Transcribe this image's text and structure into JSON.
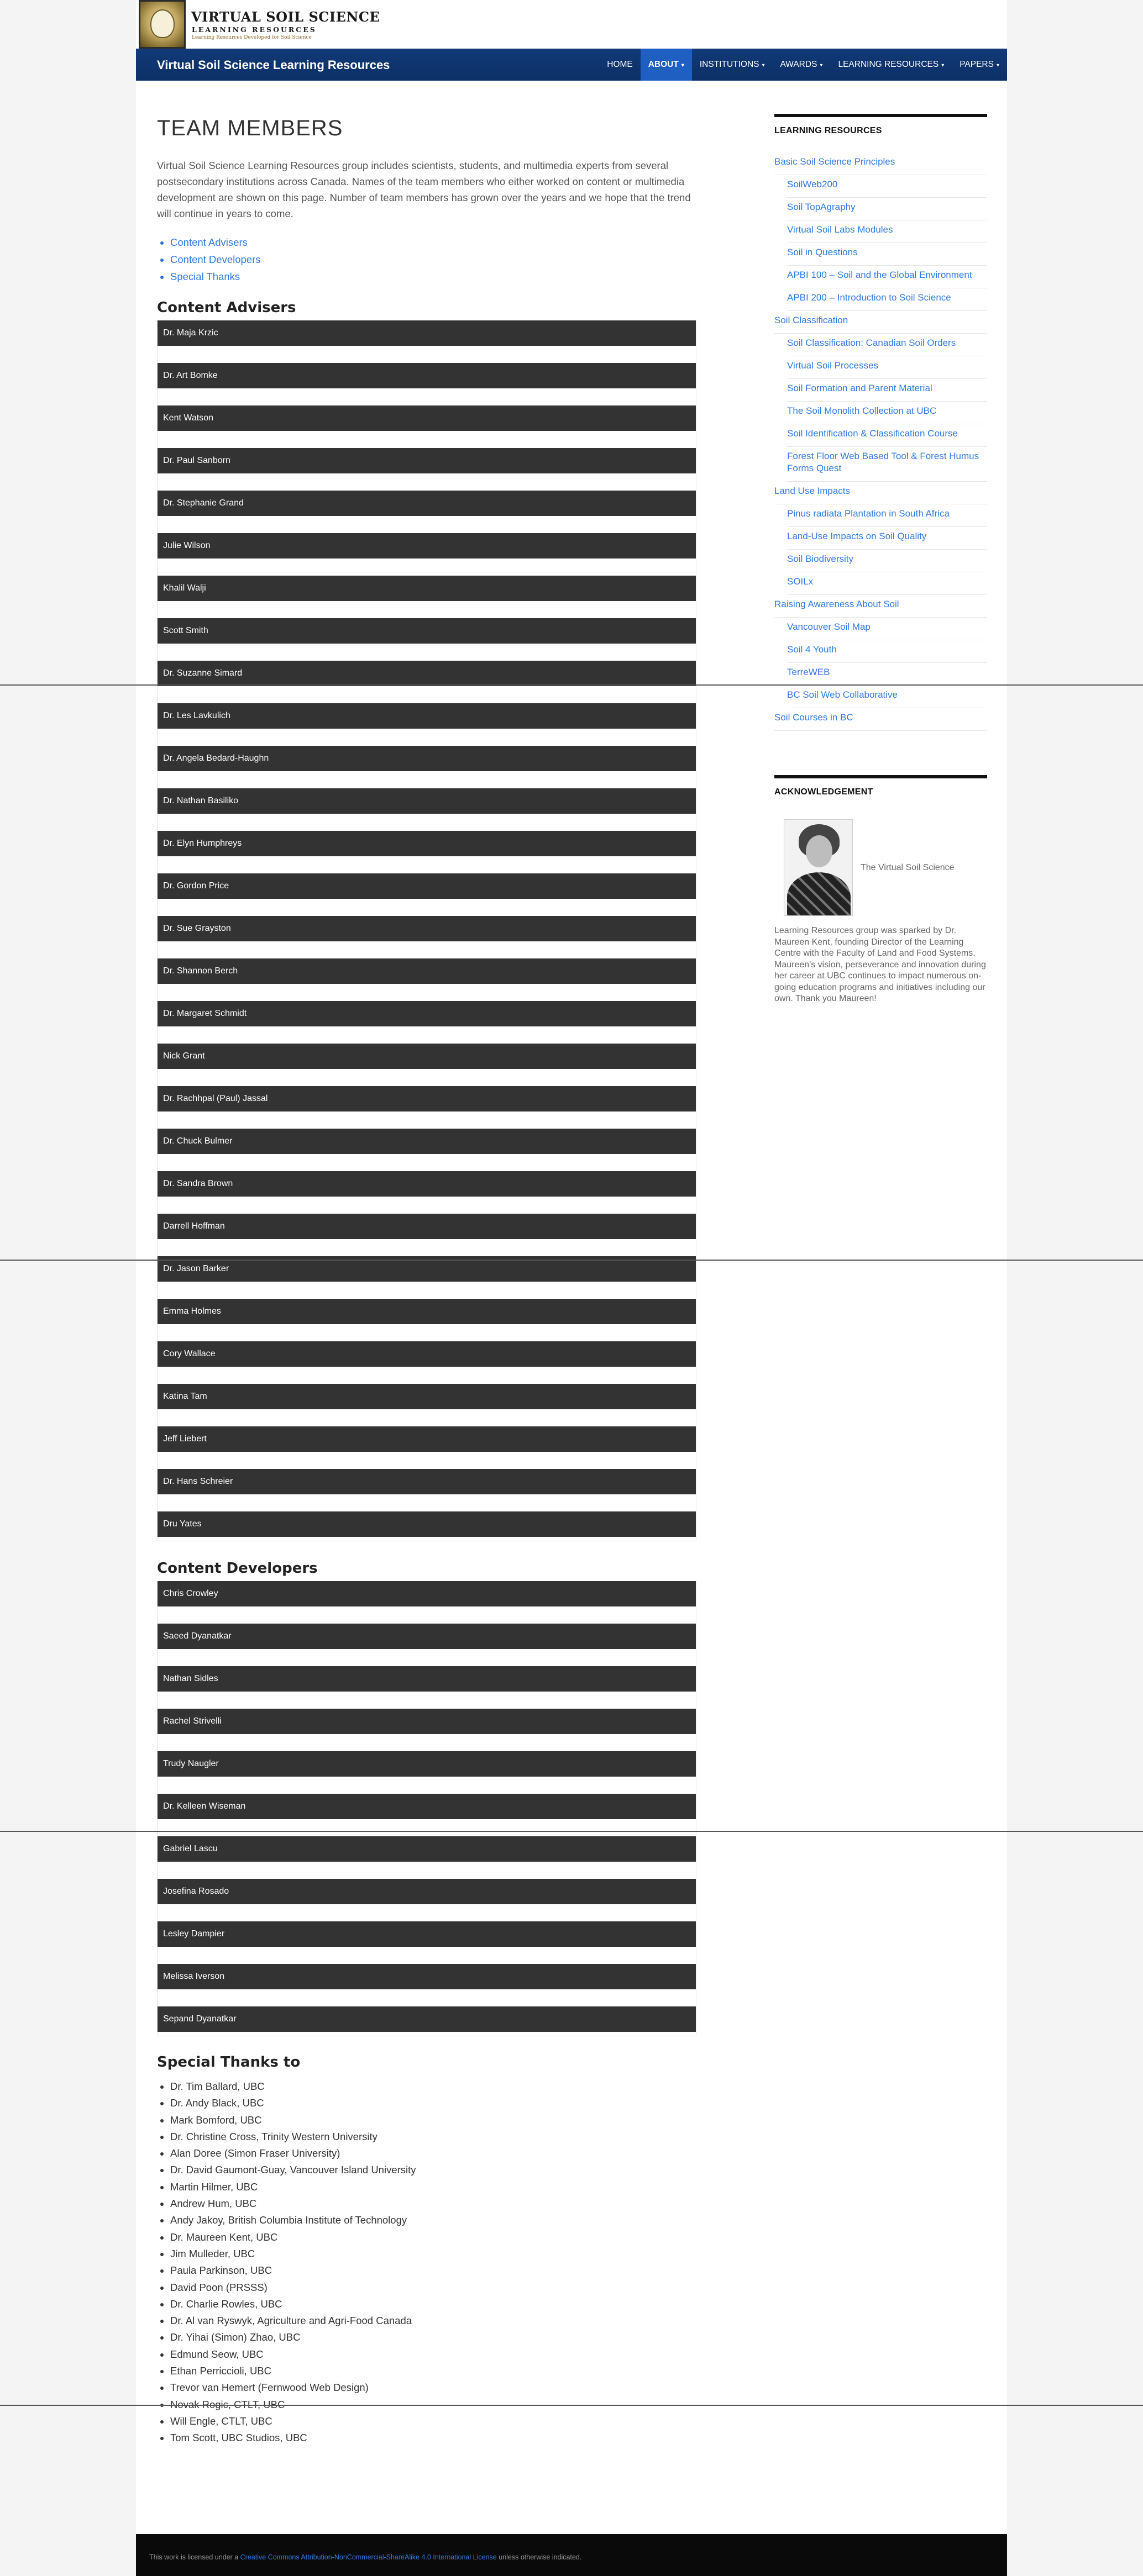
{
  "brand": {
    "title": "VIRTUAL SOIL SCIENCE",
    "subtitle": "LEARNING RESOURCES",
    "tagline": "Learning Resources Developed for Soil Science"
  },
  "navbar": {
    "site_title": "Virtual Soil Science Learning Resources",
    "items": [
      {
        "label": "HOME",
        "dropdown": false,
        "active": false
      },
      {
        "label": "ABOUT",
        "dropdown": true,
        "active": true
      },
      {
        "label": "INSTITUTIONS",
        "dropdown": true,
        "active": false
      },
      {
        "label": "AWARDS",
        "dropdown": true,
        "active": false
      },
      {
        "label": "LEARNING RESOURCES",
        "dropdown": true,
        "active": false
      },
      {
        "label": "PAPERS",
        "dropdown": true,
        "active": false
      }
    ],
    "caret": "▾"
  },
  "main": {
    "title": "TEAM MEMBERS",
    "intro": "Virtual Soil Science Learning Resources group includes scientists, students, and multimedia experts from several postsecondary institutions across Canada. Names of the team members who either worked on content or multimedia development are shown on this page. Number of team members has grown over the years and we hope that the trend will continue in years to come.",
    "toc": [
      "Content Advisers",
      "Content Developers",
      "Special Thanks"
    ],
    "advisers_heading": "Content Advisers",
    "advisers": [
      "Dr. Maja Krzic",
      "Dr. Art Bomke",
      "Kent Watson",
      "Dr. Paul Sanborn",
      "Dr. Stephanie Grand",
      "Julie Wilson",
      "Khalil Walji",
      "Scott Smith",
      "Dr. Suzanne Simard",
      "Dr. Les Lavkulich",
      "Dr. Angela Bedard-Haughn",
      "Dr. Nathan Basiliko",
      "Dr. Elyn Humphreys",
      "Dr. Gordon Price",
      "Dr. Sue Grayston",
      "Dr. Shannon Berch",
      "Dr. Margaret Schmidt",
      "Nick Grant",
      "Dr. Rachhpal (Paul) Jassal",
      "Dr. Chuck Bulmer",
      "Dr. Sandra Brown",
      "Darrell Hoffman",
      "Dr. Jason Barker",
      "Emma Holmes",
      "Cory Wallace",
      "Katina Tam",
      "Jeff Liebert",
      "Dr. Hans Schreier",
      "Dru Yates"
    ],
    "developers_heading": "Content Developers",
    "developers": [
      "Chris Crowley",
      "Saeed Dyanatkar",
      "Nathan Sidles",
      "Rachel Strivelli",
      "Trudy Naugler",
      "Dr. Kelleen Wiseman",
      "Gabriel Lascu",
      "Josefina Rosado",
      "Lesley Dampier",
      "Melissa Iverson",
      "Sepand Dyanatkar"
    ],
    "thanks_heading": "Special Thanks to",
    "thanks": [
      "Dr. Tim Ballard, UBC",
      "Dr. Andy Black, UBC",
      "Mark Bomford, UBC",
      "Dr. Christine Cross, Trinity Western University",
      "Alan Doree (Simon Fraser University)",
      "Dr. David Gaumont-Guay, Vancouver Island University",
      "Martin Hilmer, UBC",
      "Andrew Hum, UBC",
      "Andy Jakoy, British Columbia Institute of Technology",
      "Dr. Maureen Kent, UBC",
      "Jim Mulleder, UBC",
      "Paula Parkinson, UBC",
      "David Poon (PRSSS)",
      "Dr. Charlie Rowles, UBC",
      "Dr. Al van Ryswyk, Agriculture and Agri-Food Canada",
      "Dr. Yihai (Simon) Zhao, UBC",
      "Edmund Seow, UBC",
      "Ethan Perriccioli, UBC",
      "Trevor van Hemert (Fernwood Web Design)",
      "Novak Rogic, CTLT, UBC",
      "Will Engle, CTLT, UBC",
      "Tom Scott, UBC Studios, UBC"
    ]
  },
  "sidebar": {
    "resources_title": "LEARNING RESOURCES",
    "resources": [
      {
        "label": "Basic Soil Science Principles",
        "sub": false
      },
      {
        "label": "SoilWeb200",
        "sub": true
      },
      {
        "label": "Soil TopAgraphy",
        "sub": true
      },
      {
        "label": "Virtual Soil Labs Modules",
        "sub": true
      },
      {
        "label": "Soil in Questions",
        "sub": true
      },
      {
        "label": "APBI 100 – Soil and the Global Environment",
        "sub": true
      },
      {
        "label": "APBI 200 – Introduction to Soil Science",
        "sub": true
      },
      {
        "label": "Soil Classification",
        "sub": false
      },
      {
        "label": "Soil Classification: Canadian Soil Orders",
        "sub": true
      },
      {
        "label": "Virtual Soil Processes",
        "sub": true
      },
      {
        "label": "Soil Formation and Parent Material",
        "sub": true
      },
      {
        "label": "The Soil Monolith Collection at UBC",
        "sub": true
      },
      {
        "label": "Soil Identification & Classification Course",
        "sub": true
      },
      {
        "label": "Forest Floor Web Based Tool & Forest Humus Forms Quest",
        "sub": true
      },
      {
        "label": "Land Use Impacts",
        "sub": false
      },
      {
        "label": "Pinus radiata Plantation in South Africa",
        "sub": true
      },
      {
        "label": "Land-Use Impacts on Soil Quality",
        "sub": true
      },
      {
        "label": "Soil Biodiversity",
        "sub": true
      },
      {
        "label": "SOILx",
        "sub": true
      },
      {
        "label": "Raising Awareness About Soil",
        "sub": false
      },
      {
        "label": "Vancouver Soil Map",
        "sub": true
      },
      {
        "label": "Soil 4 Youth",
        "sub": true
      },
      {
        "label": "TerreWEB",
        "sub": true
      },
      {
        "label": "BC Soil Web Collaborative",
        "sub": true
      },
      {
        "label": "Soil Courses in BC",
        "sub": false
      }
    ],
    "ack_title": "ACKNOWLEDGEMENT",
    "ack_caption": "The Virtual Soil Science",
    "ack_text": "Learning Resources group was sparked by Dr. Maureen Kent, founding Director of the Learning Centre with the Faculty of Land and Food Systems. Maureen's vision, perseverance and innovation during her career at UBC continues to impact numerous on-going education programs and initiatives including our own. Thank you Maureen!"
  },
  "footer": {
    "prefix": "This work is licensed under a ",
    "license": "Creative Commons Attribution-NonCommercial-ShareAlike 4.0 International License",
    "suffix": " unless otherwise indicated."
  }
}
